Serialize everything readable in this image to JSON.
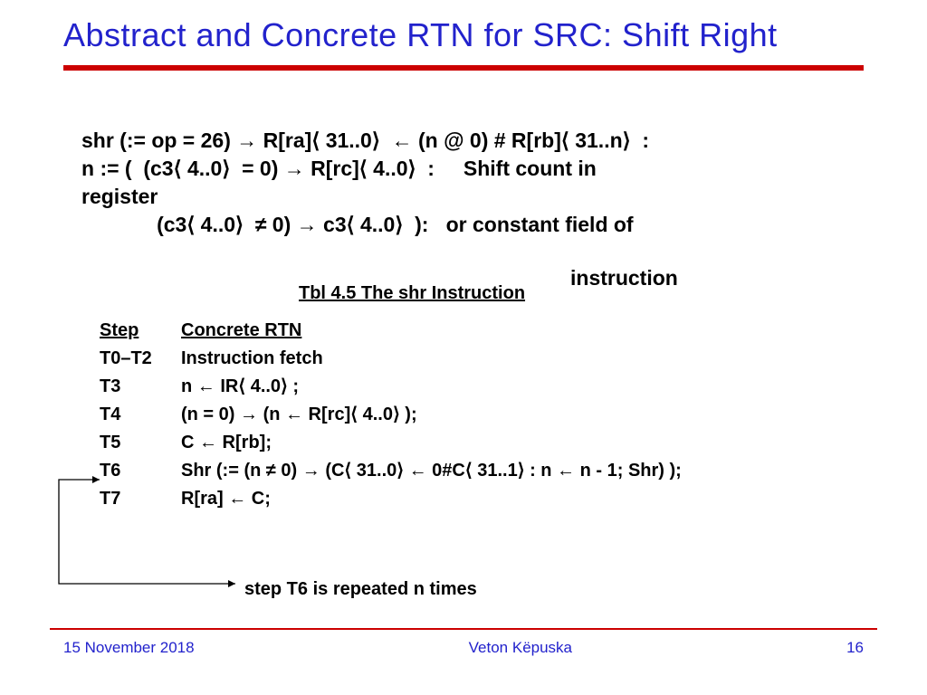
{
  "title": "Abstract and Concrete RTN for SRC: Shift Right",
  "abstract": {
    "line1": "shr (:= op = 26) → R[ra]⟨ 31..0⟩  ← (n @ 0) # R[rb]⟨ 31..n⟩  :",
    "line2": "n := (  (c3⟨ 4..0⟩  = 0) → R[rc]⟨ 4..0⟩  :     Shift count in",
    "line3": "register",
    "line4": "             (c3⟨ 4..0⟩  ≠ 0) → c3⟨ 4..0⟩  ):   or constant field of",
    "line4b": "instruction"
  },
  "tableCaption": "Tbl 4.5  The shr Instruction",
  "columns": {
    "step": "Step",
    "rtn": "Concrete RTN"
  },
  "rows": [
    {
      "step": "T0–T2",
      "rtn": "Instruction fetch"
    },
    {
      "step": "T3",
      "rtn": "n ← IR⟨ 4..0⟩ ;"
    },
    {
      "step": "T4",
      "rtn": "(n = 0) → (n ← R[rc]⟨ 4..0⟩ );"
    },
    {
      "step": "T5",
      "rtn": "C ← R[rb];"
    },
    {
      "step": "T6",
      "rtn": "Shr (:= (n ≠ 0)  → (C⟨ 31..0⟩  ← 0#C⟨ 31..1⟩ : n ← n - 1; Shr) );"
    },
    {
      "step": "T7",
      "rtn": "R[ra] ← C;"
    }
  ],
  "footnote": "step T6 is repeated n times",
  "footer": {
    "date": "15 November 2018",
    "author": "Veton Këpuska",
    "page": "16"
  }
}
